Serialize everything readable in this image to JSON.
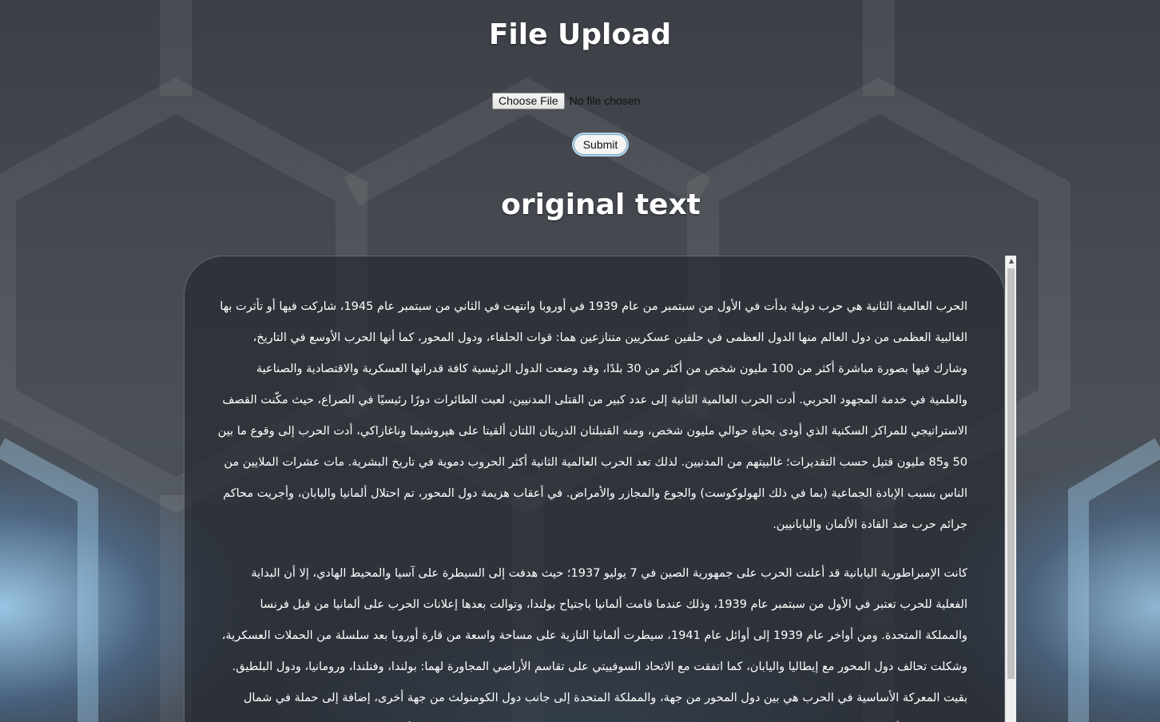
{
  "header": {
    "title": "File Upload"
  },
  "upload": {
    "choose_label": "Choose File",
    "status": "No file chosen",
    "submit_label": "Submit"
  },
  "section": {
    "title": "original text"
  },
  "document": {
    "paragraphs": [
      "الحرب العالمية الثانية هي حرب دولية بدأت في الأول من سبتمبر من عام 1939 في أوروبا وانتهت في الثاني من سبتمبر عام 1945، شاركت فيها أو تأثرت بها الغالبية العظمى من دول العالم منها الدول العظمى في حلفين عسكريين متنازعين هما: قوات الحلفاء، ودول المحور، كما أنها الحرب الأوسع في التاريخ، وشارك فيها بصورة مباشرة أكثر من 100 مليون شخص من أكثر من 30 بلدًا، وقد وضعت الدول الرئيسية كافة قدراتها العسكرية والاقتصادية والصناعية والعلمية في خدمة المجهود الحربي. أدت الحرب العالمية الثانية إلى عدد كبير من القتلى المدنيين، لعبت الطائرات دورًا رئيسيًا في الصراع، حيث مكّنت القصف الاستراتيجي للمراكز السكنية الذي أودى بحياة حوالي مليون شخص، ومنه القنبلتان الذريتان اللتان ألقيتا على هيروشيما وناغازاكي، أدت الحرب إلى وقوع ما بين 50 و85 مليون قتيل حسب التقديرات؛ غالبيتهم من المدنيين. لذلك تعد الحرب العالمية الثانية أكثر الحروب دموية في تاريخ البشرية. مات عشرات الملايين من الناس بسبب الإبادة الجماعية (بما في ذلك الهولوكوست) والجوع والمجازر والأمراض. في أعقاب هزيمة دول المحور، تم احتلال ألمانيا واليابان، وأجريت محاكم جرائم حرب ضد القادة الألمان واليابانيين.",
      "كانت الإمبراطورية اليابانية قد أعلنت الحرب على جمهورية الصين في 7 يوليو 1937؛ حيث هدفت إلى السيطرة على آسيا والمحيط الهادي، إلا أن البداية الفعلية للحرب تعتبر في الأول من سبتمبر عام 1939، وذلك عندما قامت ألمانيا باجتياح بولندا، وتوالت بعدها إعلانات الحرب على ألمانيا من قبل فرنسا والمملكة المتحدة. ومن أواخر عام 1939 إلى أوائل عام 1941، سيطرت ألمانيا النازية على مساحة واسعة من قارة أوروبا بعد سلسلة من الحملات العسكرية، وشكلت تحالف دول المحور مع إيطاليا واليابان، كما اتفقت مع الاتحاد السوفييتي على تقاسم الأراضي المجاورة لهما: بولندا، وفنلندا، ورومانيا، ودول البلطيق. بقيت المعركة الأساسية في الحرب هي بين دول المحور من جهة، والمملكة المتحدة إلى جانب دول الكومنولث من جهة أخرى، إضافة إلى حملة في شمال إفريقيا وحملة أخرى في شرق إفريقيا، إضافة إلى معركة برلين الجوية وقصف لندن، وحملة البلقان، ومعركة المحيط الأطلسي."
    ]
  }
}
